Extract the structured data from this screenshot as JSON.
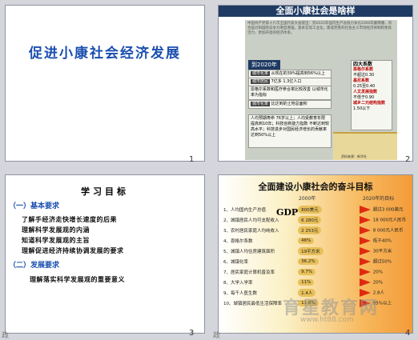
{
  "slide1": {
    "title": "促进小康社会经济发展",
    "number": "1"
  },
  "slide2": {
    "header": "全面小康社会是啥样",
    "intro": "中国共产党第十六次全国代表大会提出：到2020年国内生产总值力争比2000年翻两番，综合国力和国际竞争力明显增强。基本实现工业化，建成完善的社会主义市场经济体制和更具活力、更加开放的经济体系。",
    "badge": "到2020年",
    "left_boxes": [
      {
        "hl": "城市化率",
        "text": "从现在的39%提高到56%以上"
      },
      {
        "hl": "城市居民",
        "text": "7亿多 1.3亿人口"
      },
      {
        "hl": "",
        "text": "恩格尔系数和医疗参合率比较改善 以城市化率为指标"
      },
      {
        "hl": "城市化率",
        "text": "比达到的土地总面积"
      },
      {
        "hl": "",
        "text": "人均预期寿命 76岁以上；人均受教育年限 提高到10年；科技创新能力指数 不断达到较高水平；科技进步对国民经济增长的贡献率 达到50%以上"
      }
    ],
    "right_box": {
      "title": "四大系数",
      "rows": [
        {
          "label": "恩格尔系数",
          "value": "不超过0.30"
        },
        {
          "label": "基尼系数",
          "value": "0.25至0.40"
        },
        {
          "label": "人文发展指数",
          "value": "不低于0.90"
        },
        {
          "label": "城乡二元结构指数",
          "value": "1.50以下"
        }
      ]
    },
    "caption": "资料来源：新华社",
    "number": "2"
  },
  "slide3": {
    "title": "学习目标",
    "sections": [
      {
        "heading": "（一）基本要求",
        "items": [
          "了解手经济走快增长速度的后果",
          "理解科学发展观的内涵",
          "知道科学发展观的主旨",
          "理解促进经济持续协调发展的要求"
        ]
      },
      {
        "heading": "（二）发展要求",
        "items": [
          "理解落实科学发展观的重要意义"
        ]
      }
    ],
    "number": "3",
    "corner": "政"
  },
  "slide4": {
    "title": "全面建设小康社会的奋斗目标",
    "col_2000": "2000年",
    "col_2020": "2020年的目标",
    "gdp_label": "GDP",
    "rows": [
      {
        "label": "1、人均国内生产总值",
        "v2000": "800美元",
        "v2020": "超过3 000美元"
      },
      {
        "label": "2、城镇居民人均可支配收入",
        "v2000": "6 280元",
        "v2020": "18 000元人民币"
      },
      {
        "label": "3、农村居民家庭人均纯收入",
        "v2000": "2 253元",
        "v2020": "8 000元人民币"
      },
      {
        "label": "4、恩格尔系数",
        "v2000": "46%",
        "v2020": "低于40%"
      },
      {
        "label": "5、城镇人均住房建筑面积",
        "v2000": "19平方米",
        "v2020": "30平方米"
      },
      {
        "label": "6、城镇化率",
        "v2000": "36.2%",
        "v2020": "超过50%"
      },
      {
        "label": "7、居民家庭计算机普及率",
        "v2000": "9.7%",
        "v2020": "20%"
      },
      {
        "label": "8、大学入学率",
        "v2000": "11%",
        "v2020": "20%"
      },
      {
        "label": "9、每千人医生数",
        "v2000": "1.4人",
        "v2020": "2.8人"
      },
      {
        "label": "10、城镇居民最低生活保障率",
        "v2000": "11.6%",
        "v2020": "95%以上"
      }
    ],
    "watermark": "育星教育网",
    "watermark_url": "www.ht88.com",
    "number": "4",
    "corner": "政"
  }
}
